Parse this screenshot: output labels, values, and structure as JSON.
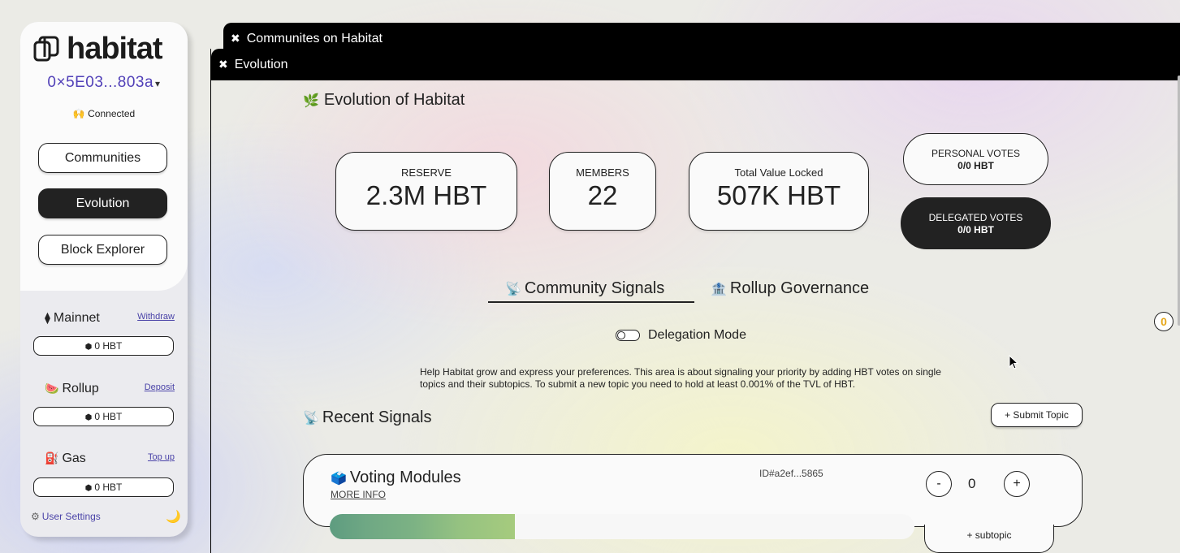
{
  "sidebar": {
    "logo_text": "habitat",
    "address": "0×5E03...803a",
    "address_caret": "▾",
    "connection": {
      "icon": "🙌",
      "label": "Connected"
    },
    "nav": [
      {
        "label": "Communities",
        "active": false
      },
      {
        "label": "Evolution",
        "active": true
      },
      {
        "label": "Block Explorer",
        "active": false
      }
    ],
    "networks": [
      {
        "name": "Mainnet",
        "icon": "ethereum-icon",
        "icon_glyph": "⧫",
        "action": "Withdraw",
        "balance": "0 HBT"
      },
      {
        "name": "Rollup",
        "icon": "watermelon-icon",
        "icon_glyph": "🍉",
        "action": "Deposit",
        "balance": "0 HBT"
      },
      {
        "name": "Gas",
        "icon": "fuel-pump-icon",
        "icon_glyph": "⛽",
        "action": "Top up",
        "balance": "0 HBT"
      }
    ],
    "coin_glyph": "⬢",
    "user_settings": "User Settings",
    "settings_glyph": "⚙",
    "moon_glyph": "🌙"
  },
  "windows": {
    "back_title": "Communites on Habitat",
    "front_title": "Evolution",
    "close_glyph": "✖"
  },
  "page": {
    "title": "Evolution of Habitat",
    "title_glyph": "🌿",
    "stats": {
      "reserve": {
        "label": "RESERVE",
        "value": "2.3M HBT"
      },
      "members": {
        "label": "MEMBERS",
        "value": "22"
      },
      "tvl": {
        "label": "Total Value Locked",
        "value": "507K HBT"
      }
    },
    "votes": {
      "personal": {
        "label": "PERSONAL VOTES",
        "value": "0/0 HBT"
      },
      "delegated": {
        "label": "DELEGATED VOTES",
        "value": "0/0 HBT"
      }
    },
    "tabs": [
      {
        "label": "Community Signals",
        "glyph": "📡",
        "active": true
      },
      {
        "label": "Rollup Governance",
        "glyph": "🏦",
        "active": false
      }
    ],
    "delegation_label": "Delegation Mode",
    "help_text": "Help Habitat grow and express your preferences. This area is about signaling your priority by adding HBT votes on single topics and their subtopics. To submit a new topic you need to hold at least 0.001% of the TVL of HBT.",
    "recent_title": "Recent Signals",
    "recent_glyph": "📡",
    "submit_label": "+ Submit Topic",
    "signal": {
      "title": "Voting Modules",
      "glyph": "🗳️",
      "more_info": "MORE INFO",
      "id": "ID#a2ef...5865",
      "minus": "-",
      "count": "0",
      "plus": "+",
      "progress": 0.316,
      "subtopic_label": "+ subtopic"
    },
    "notification_count": "0"
  }
}
